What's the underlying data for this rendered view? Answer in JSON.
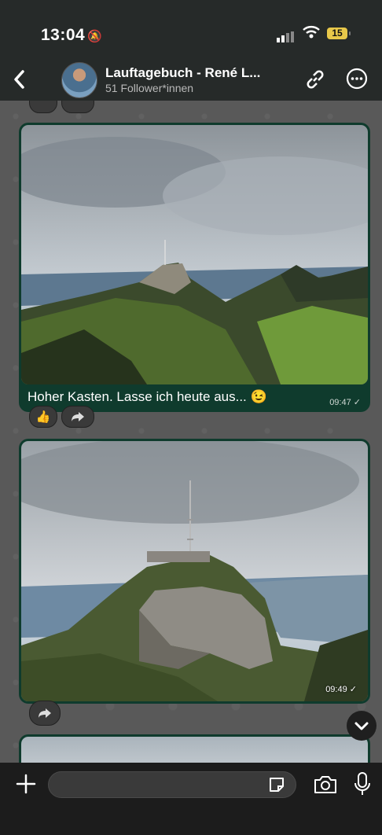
{
  "status_bar": {
    "time": "13:04",
    "battery": "15"
  },
  "header": {
    "title": "Lauftagebuch - René L...",
    "subtitle": "51 Follower*innen"
  },
  "messages": [
    {
      "caption": "Hoher Kasten. Lasse ich heute aus... 😉",
      "time": "09:47 ✓",
      "reaction": "👍"
    },
    {
      "caption": "",
      "time": "09:49 ✓"
    }
  ],
  "composer": {
    "placeholder": ""
  },
  "icons": [
    "back-icon",
    "link-icon",
    "more-icon",
    "thumbs-up-icon",
    "forward-icon",
    "chevron-down-icon",
    "plus-icon",
    "sticker-icon",
    "camera-icon",
    "mic-icon"
  ]
}
